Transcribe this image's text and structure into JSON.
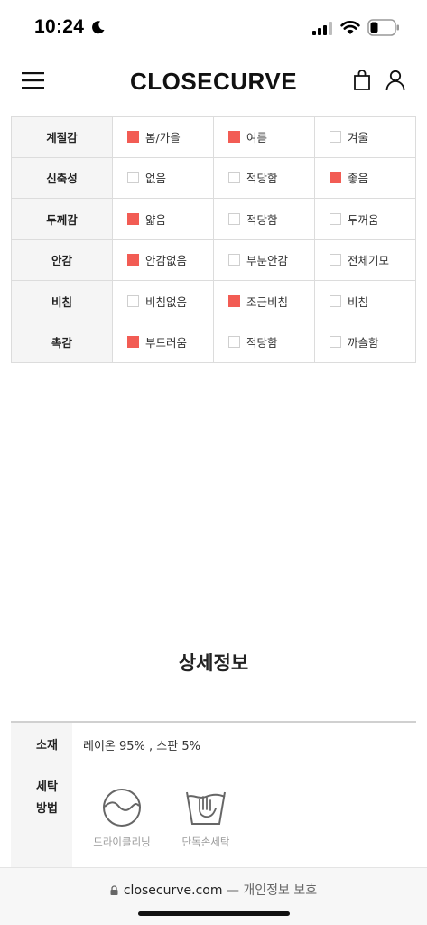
{
  "status": {
    "time": "10:24"
  },
  "header": {
    "brand": "CLOSECURVE"
  },
  "attributes": [
    {
      "label": "계절감",
      "options": [
        {
          "text": "봄/가을",
          "checked": true
        },
        {
          "text": "여름",
          "checked": true
        },
        {
          "text": "겨울",
          "checked": false
        }
      ]
    },
    {
      "label": "신축성",
      "options": [
        {
          "text": "없음",
          "checked": false
        },
        {
          "text": "적당함",
          "checked": false
        },
        {
          "text": "좋음",
          "checked": true
        }
      ]
    },
    {
      "label": "두께감",
      "options": [
        {
          "text": "얇음",
          "checked": true
        },
        {
          "text": "적당함",
          "checked": false
        },
        {
          "text": "두꺼움",
          "checked": false
        }
      ]
    },
    {
      "label": "안감",
      "options": [
        {
          "text": "안감없음",
          "checked": true
        },
        {
          "text": "부분안감",
          "checked": false
        },
        {
          "text": "전체기모",
          "checked": false
        }
      ]
    },
    {
      "label": "비침",
      "options": [
        {
          "text": "비침없음",
          "checked": false
        },
        {
          "text": "조금비침",
          "checked": true
        },
        {
          "text": "비침",
          "checked": false
        }
      ]
    },
    {
      "label": "촉감",
      "options": [
        {
          "text": "부드러움",
          "checked": true
        },
        {
          "text": "적당함",
          "checked": false
        },
        {
          "text": "까슬함",
          "checked": false
        }
      ]
    }
  ],
  "details": {
    "title": "상세정보",
    "material_label": "소재",
    "material_value": "레이온 95% , 스판 5%",
    "wash_label_line1": "세탁",
    "wash_label_line2": "방법",
    "care": [
      {
        "icon": "dry-clean-icon",
        "caption": "드라이클리닝"
      },
      {
        "icon": "hand-wash-icon",
        "caption": "단독손세탁"
      }
    ]
  },
  "browser": {
    "domain": "closecurve.com",
    "separator": "—",
    "privacy": "개인정보 보호"
  },
  "colors": {
    "checked": "#f25c54",
    "unchecked_border": "#cfcfcf",
    "label_bg": "#f5f5f5"
  }
}
